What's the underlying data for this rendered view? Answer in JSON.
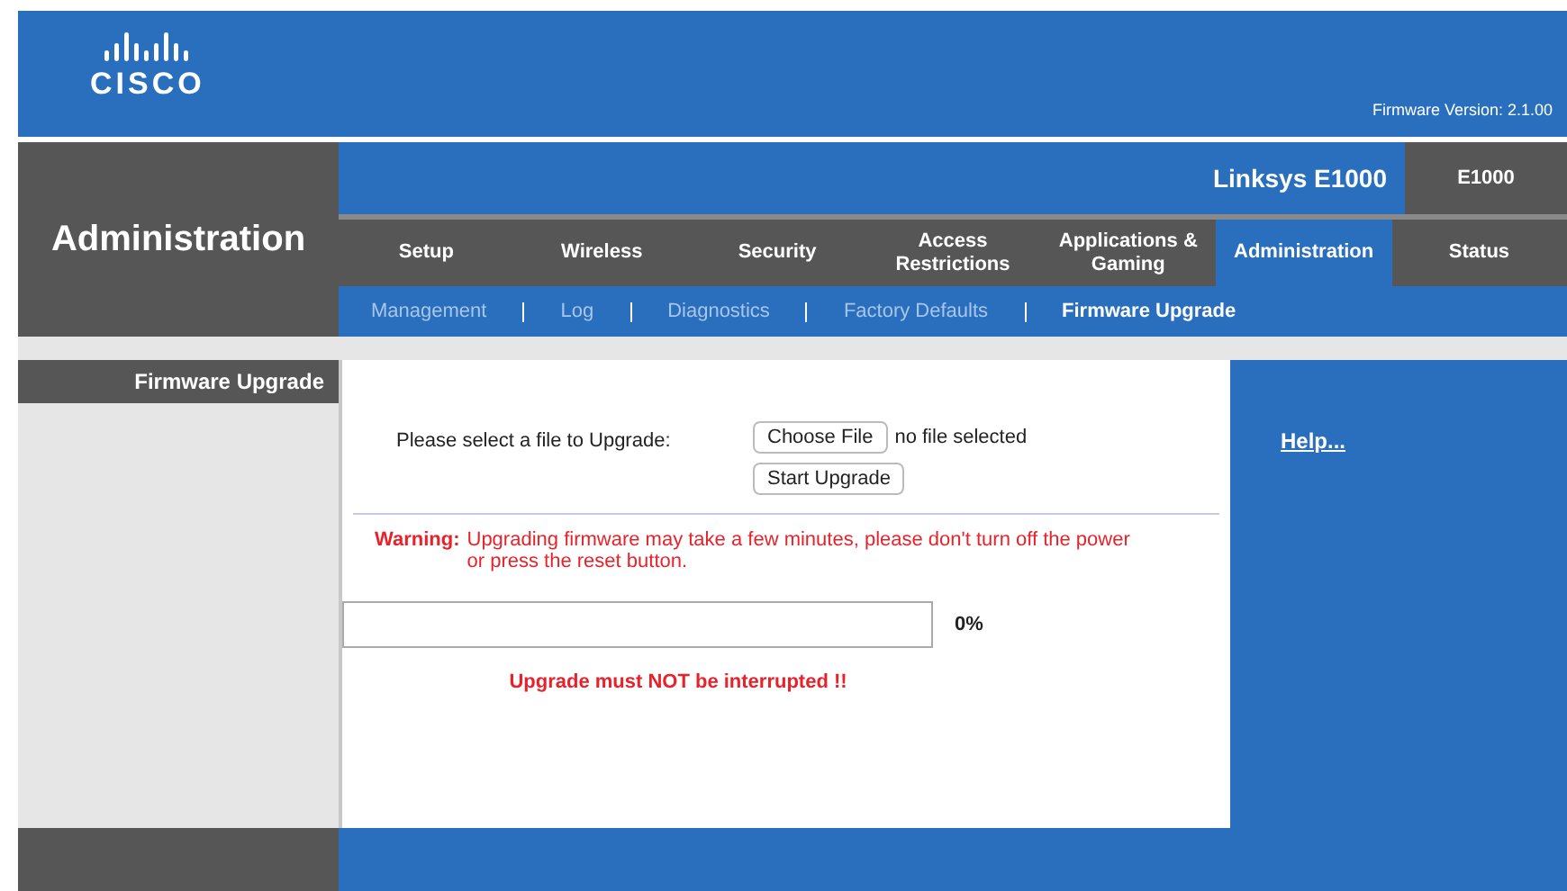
{
  "header": {
    "logo_text": "CISCO",
    "firmware_version": "Firmware Version: 2.1.00"
  },
  "section_title": "Administration",
  "product": {
    "name": "Linksys E1000",
    "model": "E1000"
  },
  "tabs": [
    {
      "label": "Setup",
      "selected": false
    },
    {
      "label": "Wireless",
      "selected": false
    },
    {
      "label": "Security",
      "selected": false
    },
    {
      "label": "Access Restrictions",
      "selected": false
    },
    {
      "label": "Applications & Gaming",
      "selected": false
    },
    {
      "label": "Administration",
      "selected": true
    },
    {
      "label": "Status",
      "selected": false
    }
  ],
  "subtabs": [
    {
      "label": "Management",
      "selected": false
    },
    {
      "label": "Log",
      "selected": false
    },
    {
      "label": "Diagnostics",
      "selected": false
    },
    {
      "label": "Factory Defaults",
      "selected": false
    },
    {
      "label": "Firmware Upgrade",
      "selected": true
    }
  ],
  "sidebar": {
    "heading": "Firmware Upgrade"
  },
  "form": {
    "label": "Please select a file to Upgrade:",
    "choose_button": "Choose File",
    "file_status": "no file selected",
    "start_button": "Start Upgrade"
  },
  "warning": {
    "prefix": "Warning:",
    "text": "Upgrading firmware may take a few minutes, please don't turn off the power or press the reset button."
  },
  "progress": {
    "level": 0,
    "reading": "0%"
  },
  "notice": "Upgrade must NOT be interrupted !!",
  "help_link": "Help..."
}
